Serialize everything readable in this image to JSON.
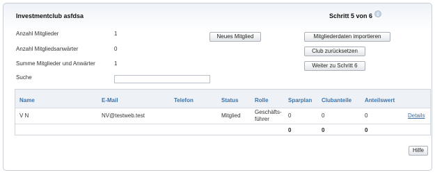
{
  "header": {
    "title": "Investmentclub asfdsa",
    "step": "Schritt 5 von 6",
    "info_icon": "info-icon"
  },
  "stats": [
    {
      "label": "Anzahl Mitglieder",
      "value": "1"
    },
    {
      "label": "Anzahl Mitgliedsanwärter",
      "value": "0"
    },
    {
      "label": "Summe Mitglieder und Anwärter",
      "value": "1"
    }
  ],
  "search": {
    "label": "Suche",
    "value": "",
    "placeholder": ""
  },
  "buttons": {
    "new_member": "Neues Mitglied",
    "import": "Mitgliederdaten importieren",
    "reset": "Club zurücksetzen",
    "next": "Weiter zu Schritt 6",
    "help": "Hilfe"
  },
  "table": {
    "headers": [
      "Name",
      "E-Mail",
      "Telefon",
      "Status",
      "Rolle",
      "Sparplan",
      "Clubanteile",
      "Anteilswert"
    ],
    "rows": [
      {
        "name": "V N",
        "email": "NV@testweb.test",
        "telefon": "",
        "status": "Mitglied",
        "rolle_line1": "Geschäfts-",
        "rolle_line2": "führer",
        "sparplan": "0",
        "clubanteile": "0",
        "anteilswert": "0",
        "details": "Details"
      }
    ],
    "totals": {
      "sparplan": "0",
      "clubanteile": "0",
      "anteilswert": "0"
    }
  },
  "colors": {
    "header_link": "#3b73a9",
    "border": "#cfd5dc",
    "accent_bg": "#eef2f7"
  }
}
